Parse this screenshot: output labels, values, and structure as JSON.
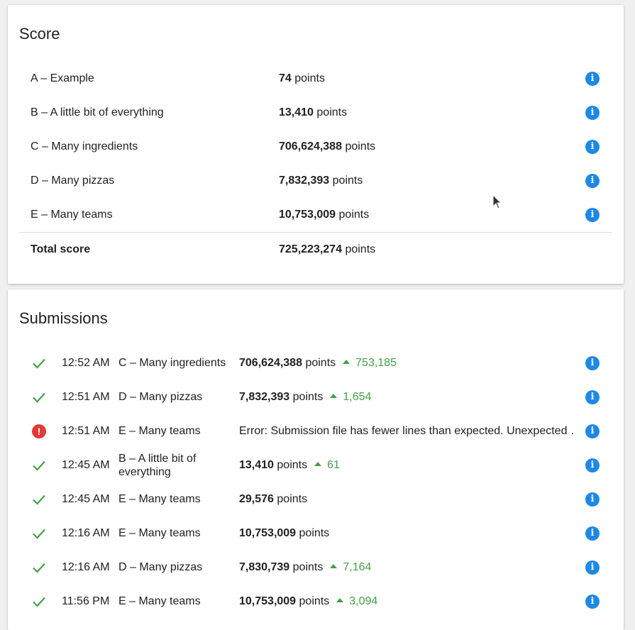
{
  "score": {
    "title": "Score",
    "points_suffix": "points",
    "rows": [
      {
        "name": "A – Example",
        "value": "74"
      },
      {
        "name": "B – A little bit of everything",
        "value": "13,410"
      },
      {
        "name": "C – Many ingredients",
        "value": "706,624,388"
      },
      {
        "name": "D – Many pizzas",
        "value": "7,832,393"
      },
      {
        "name": "E – Many teams",
        "value": "10,753,009"
      }
    ],
    "total": {
      "label": "Total score",
      "value": "725,223,274"
    }
  },
  "submissions": {
    "title": "Submissions",
    "points_suffix": "points",
    "rows": [
      {
        "status": "success",
        "time": "12:52 AM",
        "dataset": "C – Many ingredients",
        "value": "706,624,388",
        "delta": "753,185"
      },
      {
        "status": "success",
        "time": "12:51 AM",
        "dataset": "D – Many pizzas",
        "value": "7,832,393",
        "delta": "1,654"
      },
      {
        "status": "error",
        "time": "12:51 AM",
        "dataset": "E – Many teams",
        "error": "Error: Submission file has fewer lines than expected. Unexpected …"
      },
      {
        "status": "success",
        "time": "12:45 AM",
        "dataset": "B – A little bit of everything",
        "value": "13,410",
        "delta": "61"
      },
      {
        "status": "success",
        "time": "12:45 AM",
        "dataset": "E – Many teams",
        "value": "29,576",
        "delta": ""
      },
      {
        "status": "success",
        "time": "12:16 AM",
        "dataset": "E – Many teams",
        "value": "10,753,009",
        "delta": ""
      },
      {
        "status": "success",
        "time": "12:16 AM",
        "dataset": "D – Many pizzas",
        "value": "7,830,739",
        "delta": "7,164"
      },
      {
        "status": "success",
        "time": "11:56 PM",
        "dataset": "E – Many teams",
        "value": "10,753,009",
        "delta": "3,094"
      }
    ]
  },
  "colors": {
    "accent": "#1e88e5",
    "success": "#43a047",
    "error": "#e53935"
  },
  "icons": {
    "info": "info-icon",
    "success": "check-icon",
    "error": "error-icon",
    "delta": "arrow-up-icon"
  }
}
